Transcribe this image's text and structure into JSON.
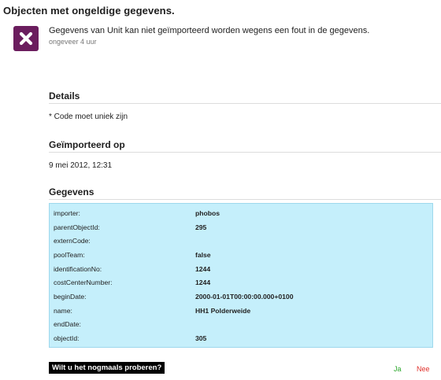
{
  "page": {
    "title": "Objecten met ongeldige gegevens."
  },
  "notification": {
    "icon": "error-close-icon",
    "icon_color": "#6b1d5e",
    "message": "Gegevens van Unit kan niet geïmporteerd worden wegens een fout in de gegevens.",
    "time": "ongeveer 4 uur"
  },
  "details": {
    "title": "Details",
    "text": "* Code moet uniek zijn"
  },
  "imported": {
    "title": "Geïmporteerd op",
    "value": "9 mei 2012, 12:31"
  },
  "data": {
    "title": "Gegevens",
    "table_bg": "#c5effb",
    "rows": [
      {
        "key": "importer:",
        "value": "phobos"
      },
      {
        "key": "parentObjectId:",
        "value": "295"
      },
      {
        "key": "externCode:",
        "value": ""
      },
      {
        "key": "poolTeam:",
        "value": "false"
      },
      {
        "key": "identificationNo:",
        "value": "1244"
      },
      {
        "key": "costCenterNumber:",
        "value": "1244"
      },
      {
        "key": "beginDate:",
        "value": "2000-01-01T00:00:00.000+0100"
      },
      {
        "key": "name:",
        "value": "HH1 Polderweide"
      },
      {
        "key": "endDate:",
        "value": ""
      },
      {
        "key": "objectId:",
        "value": "305"
      }
    ]
  },
  "retry": {
    "question": "Wilt u het nogmaals proberen?",
    "yes": "Ja",
    "no": "Nee",
    "yes_color": "#2aa72a",
    "no_color": "#e0302b"
  }
}
